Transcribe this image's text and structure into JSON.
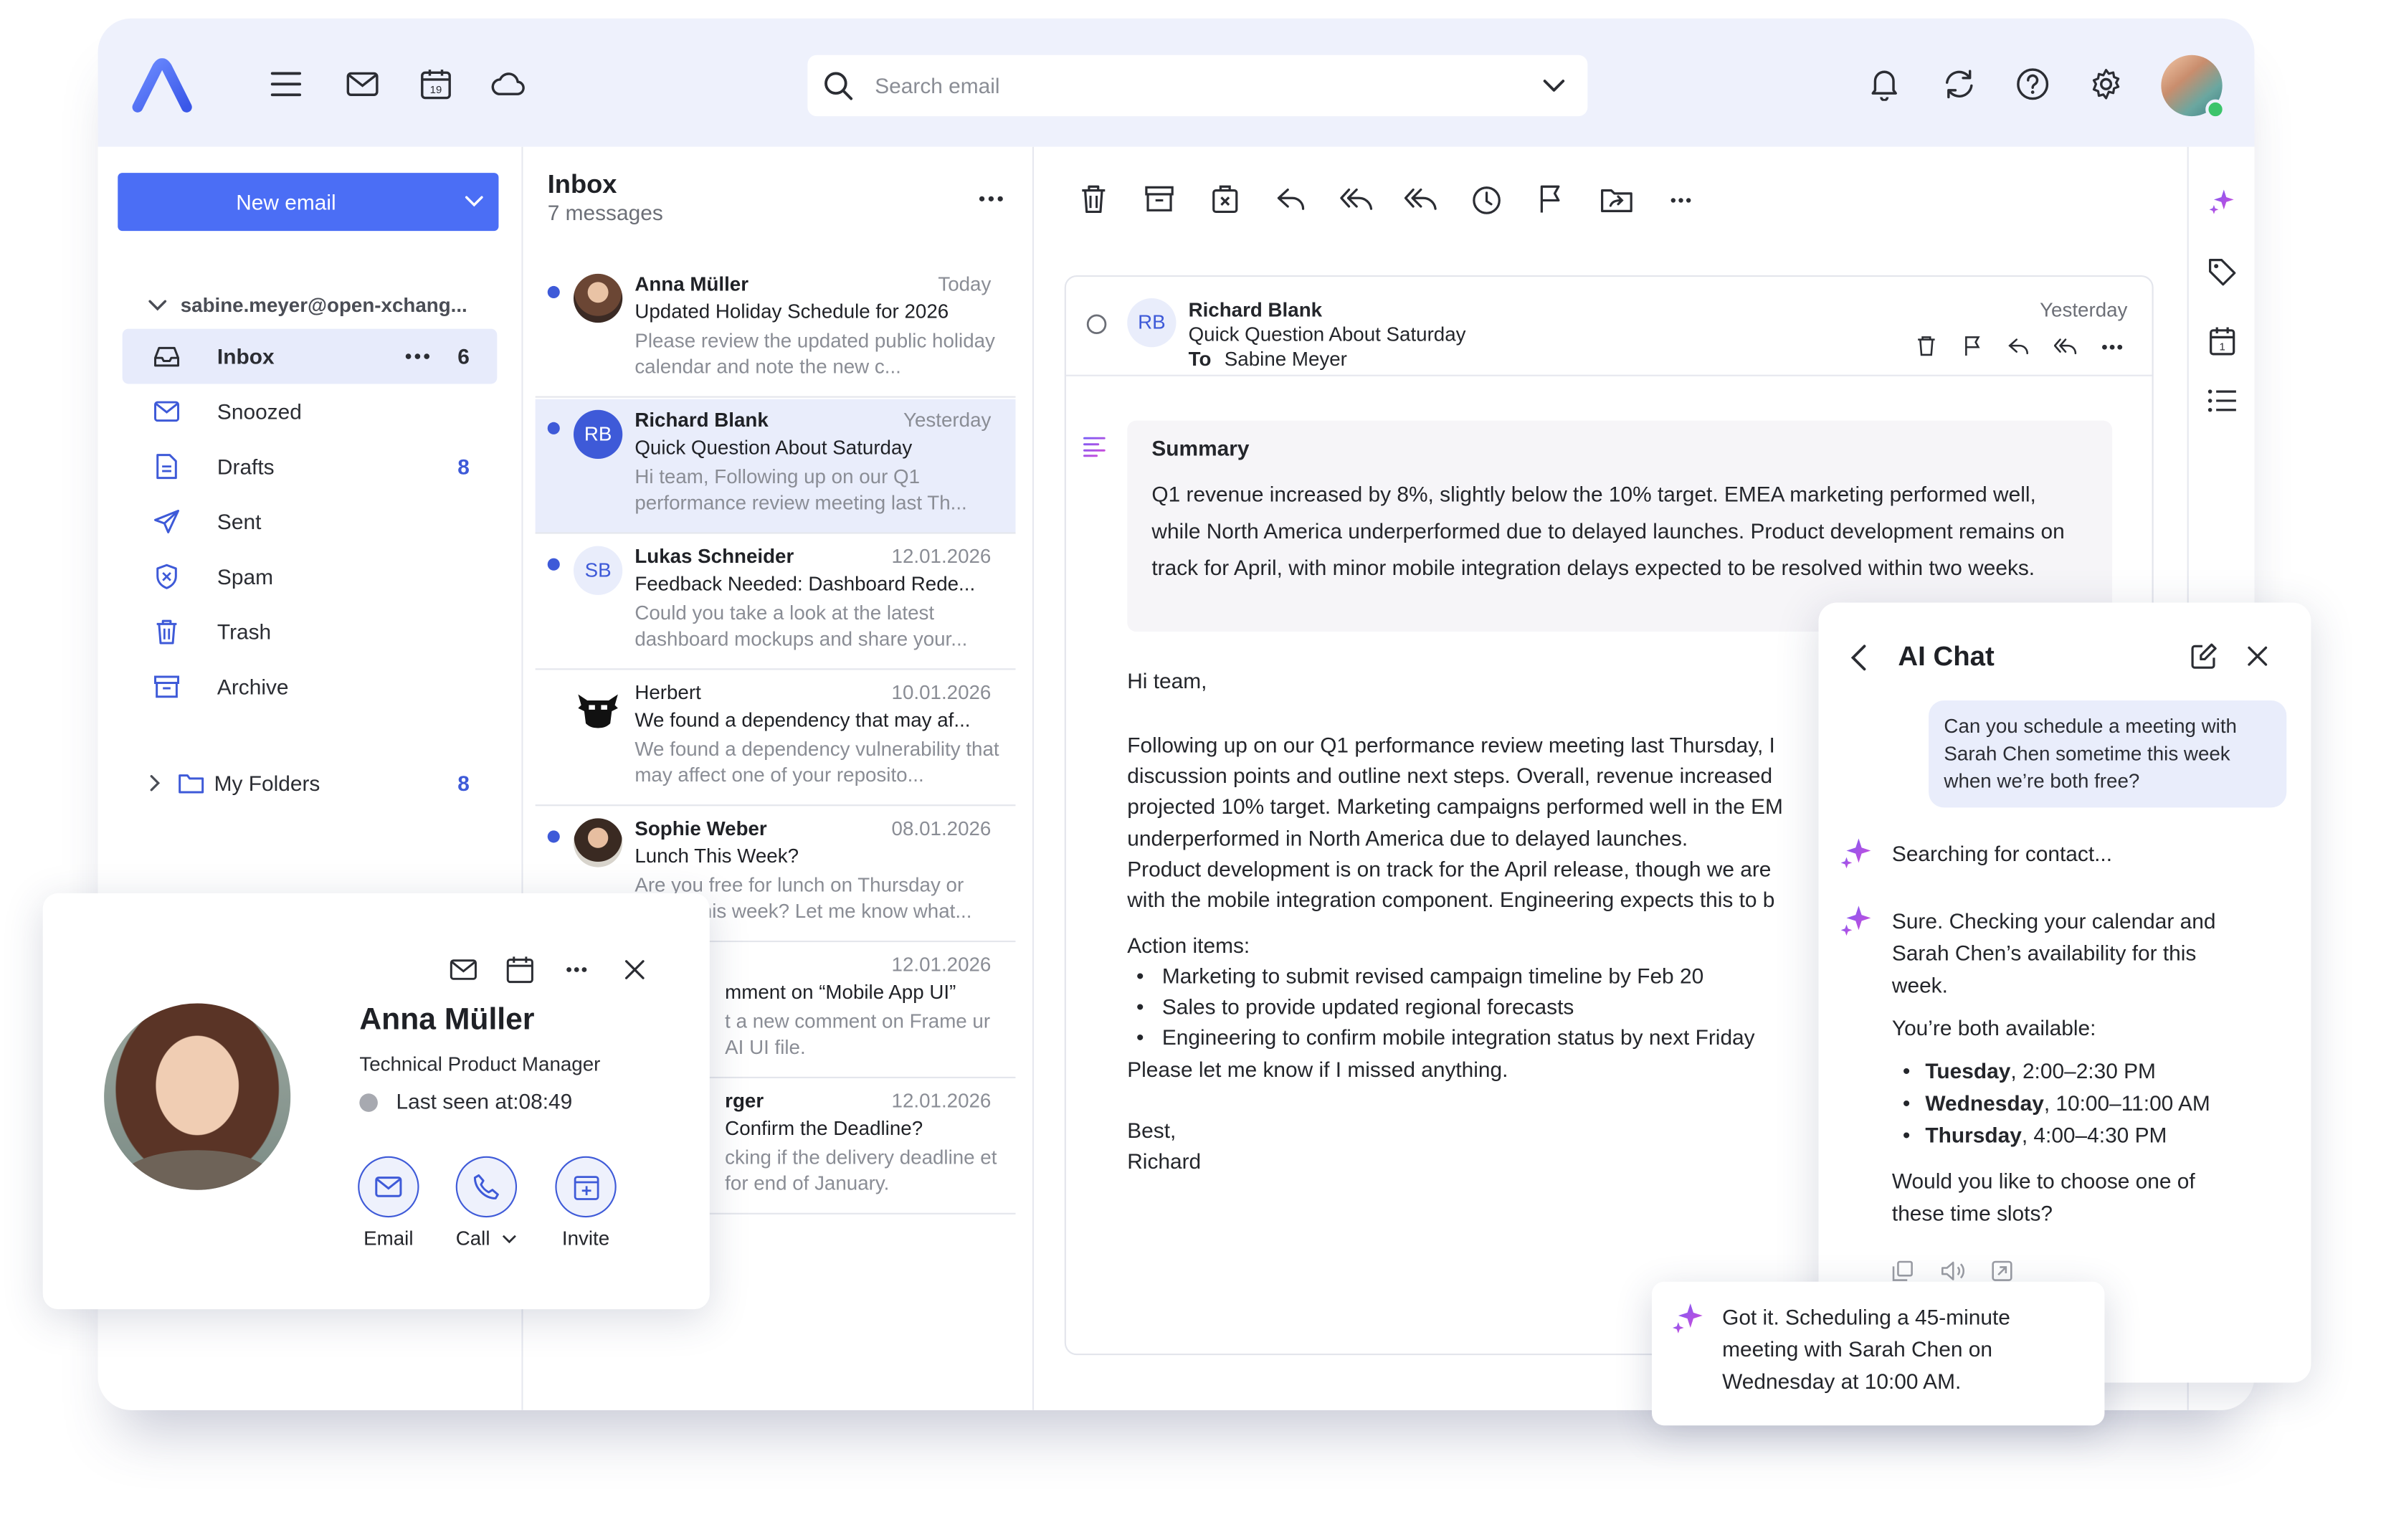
{
  "header": {
    "search_placeholder": "Search email"
  },
  "sidebar": {
    "new_email_label": "New email",
    "account": "sabine.meyer@open-xchang...",
    "folders": [
      {
        "label": "Inbox",
        "count": "6"
      },
      {
        "label": "Snoozed",
        "count": ""
      },
      {
        "label": "Drafts",
        "count": "8"
      },
      {
        "label": "Sent",
        "count": ""
      },
      {
        "label": "Spam",
        "count": ""
      },
      {
        "label": "Trash",
        "count": ""
      },
      {
        "label": "Archive",
        "count": ""
      }
    ],
    "my_folders": {
      "label": "My Folders",
      "count": "8"
    }
  },
  "list": {
    "title": "Inbox",
    "subtitle": "7 messages",
    "messages": [
      {
        "from": "Anna Müller",
        "date": "Today",
        "subject": "Updated Holiday Schedule for 2026",
        "preview": "Please review the updated public holiday calendar and note the new c..."
      },
      {
        "from": "Richard Blank",
        "initials": "RB",
        "date": "Yesterday",
        "subject": "Quick Question About Saturday",
        "preview": "Hi team, Following up on our Q1 performance review meeting last Th..."
      },
      {
        "from": "Lukas Schneider",
        "initials": "SB",
        "date": "12.01.2026",
        "subject": "Feedback Needed: Dashboard Rede...",
        "preview": "Could you take a look at the latest dashboard mockups and share your..."
      },
      {
        "from": "Herbert",
        "date": "10.01.2026",
        "subject": "We found a dependency that may af...",
        "preview": "We found a dependency vulnerability that may affect one of your reposito..."
      },
      {
        "from": "Sophie Weber",
        "date": "08.01.2026",
        "subject": "Lunch This Week?",
        "preview": "Are you free for lunch on Thursday or Friday this week? Let me know what..."
      },
      {
        "from": "",
        "date": "12.01.2026",
        "subject": "mment on “Mobile App UI”",
        "preview": "t a new comment on Frame ur AI UI file."
      },
      {
        "from": "rger",
        "date": "12.01.2026",
        "subject": "Confirm the Deadline?",
        "preview": "cking if the delivery deadline et for end of January."
      }
    ]
  },
  "reader": {
    "initials": "RB",
    "from": "Richard Blank",
    "subject": "Quick Question About Saturday",
    "to_label": "To",
    "to": "Sabine Meyer",
    "date": "Yesterday",
    "summary_title": "Summary",
    "summary_text": "Q1 revenue increased by 8%, slightly below the 10% target. EMEA marketing performed well, while North America underperformed due to delayed launches. Product development remains on track for April, with minor mobile integration delays expected to be resolved within two weeks.",
    "greeting": "Hi team,",
    "paragraph": "Following up on our Q1 performance review meeting last Thursday, I\ndiscussion points and outline next steps. Overall, revenue increased\nprojected 10% target. Marketing campaigns performed well in the EM\nunderperformed in North America due to delayed launches.\nProduct development is on track for the April release, though we are\nwith the mobile integration component. Engineering expects this to b",
    "action_title": "Action items:",
    "action_items": [
      "Marketing to submit revised campaign timeline by Feb 20",
      "Sales to provide updated regional forecasts",
      "Engineering to confirm mobile integration status by next Friday"
    ],
    "closing_line": "Please let me know if I missed anything.",
    "signoff": "Best,",
    "signature": "Richard"
  },
  "contact": {
    "name": "Anna Müller",
    "role": "Technical Product Manager",
    "last_seen": "Last seen at:08:49",
    "actions": {
      "email": "Email",
      "call": "Call",
      "invite": "Invite"
    }
  },
  "chat": {
    "title": "AI Chat",
    "user_message": "Can you schedule a meeting with Sarah Chen sometime this week when we’re both free?",
    "status_message": "Searching for contact...",
    "reply_intro": "Sure. Checking your calendar and Sarah Chen’s availability for this week.",
    "available_label": "You’re both available:",
    "slots": [
      {
        "day": "Tuesday",
        "time": ", 2:00–2:30 PM"
      },
      {
        "day": "Wednesday",
        "time": ", 10:00–11:00 AM"
      },
      {
        "day": "Thursday",
        "time": ", 4:00–4:30 PM"
      }
    ],
    "question": "Would you like to choose one of these time slots?"
  },
  "toast": {
    "text": "Got it. Scheduling a 45-minute meeting with Sarah Chen on Wednesday at 10:00 AM."
  },
  "colors": {
    "accent": "#4b6ef5",
    "topbar": "#eef1fc",
    "unread_dot": "#3e5ad8",
    "selection": "#e7ebfb",
    "ai_gradient_start": "#7b5cf5",
    "ai_gradient_end": "#d24bd8"
  }
}
